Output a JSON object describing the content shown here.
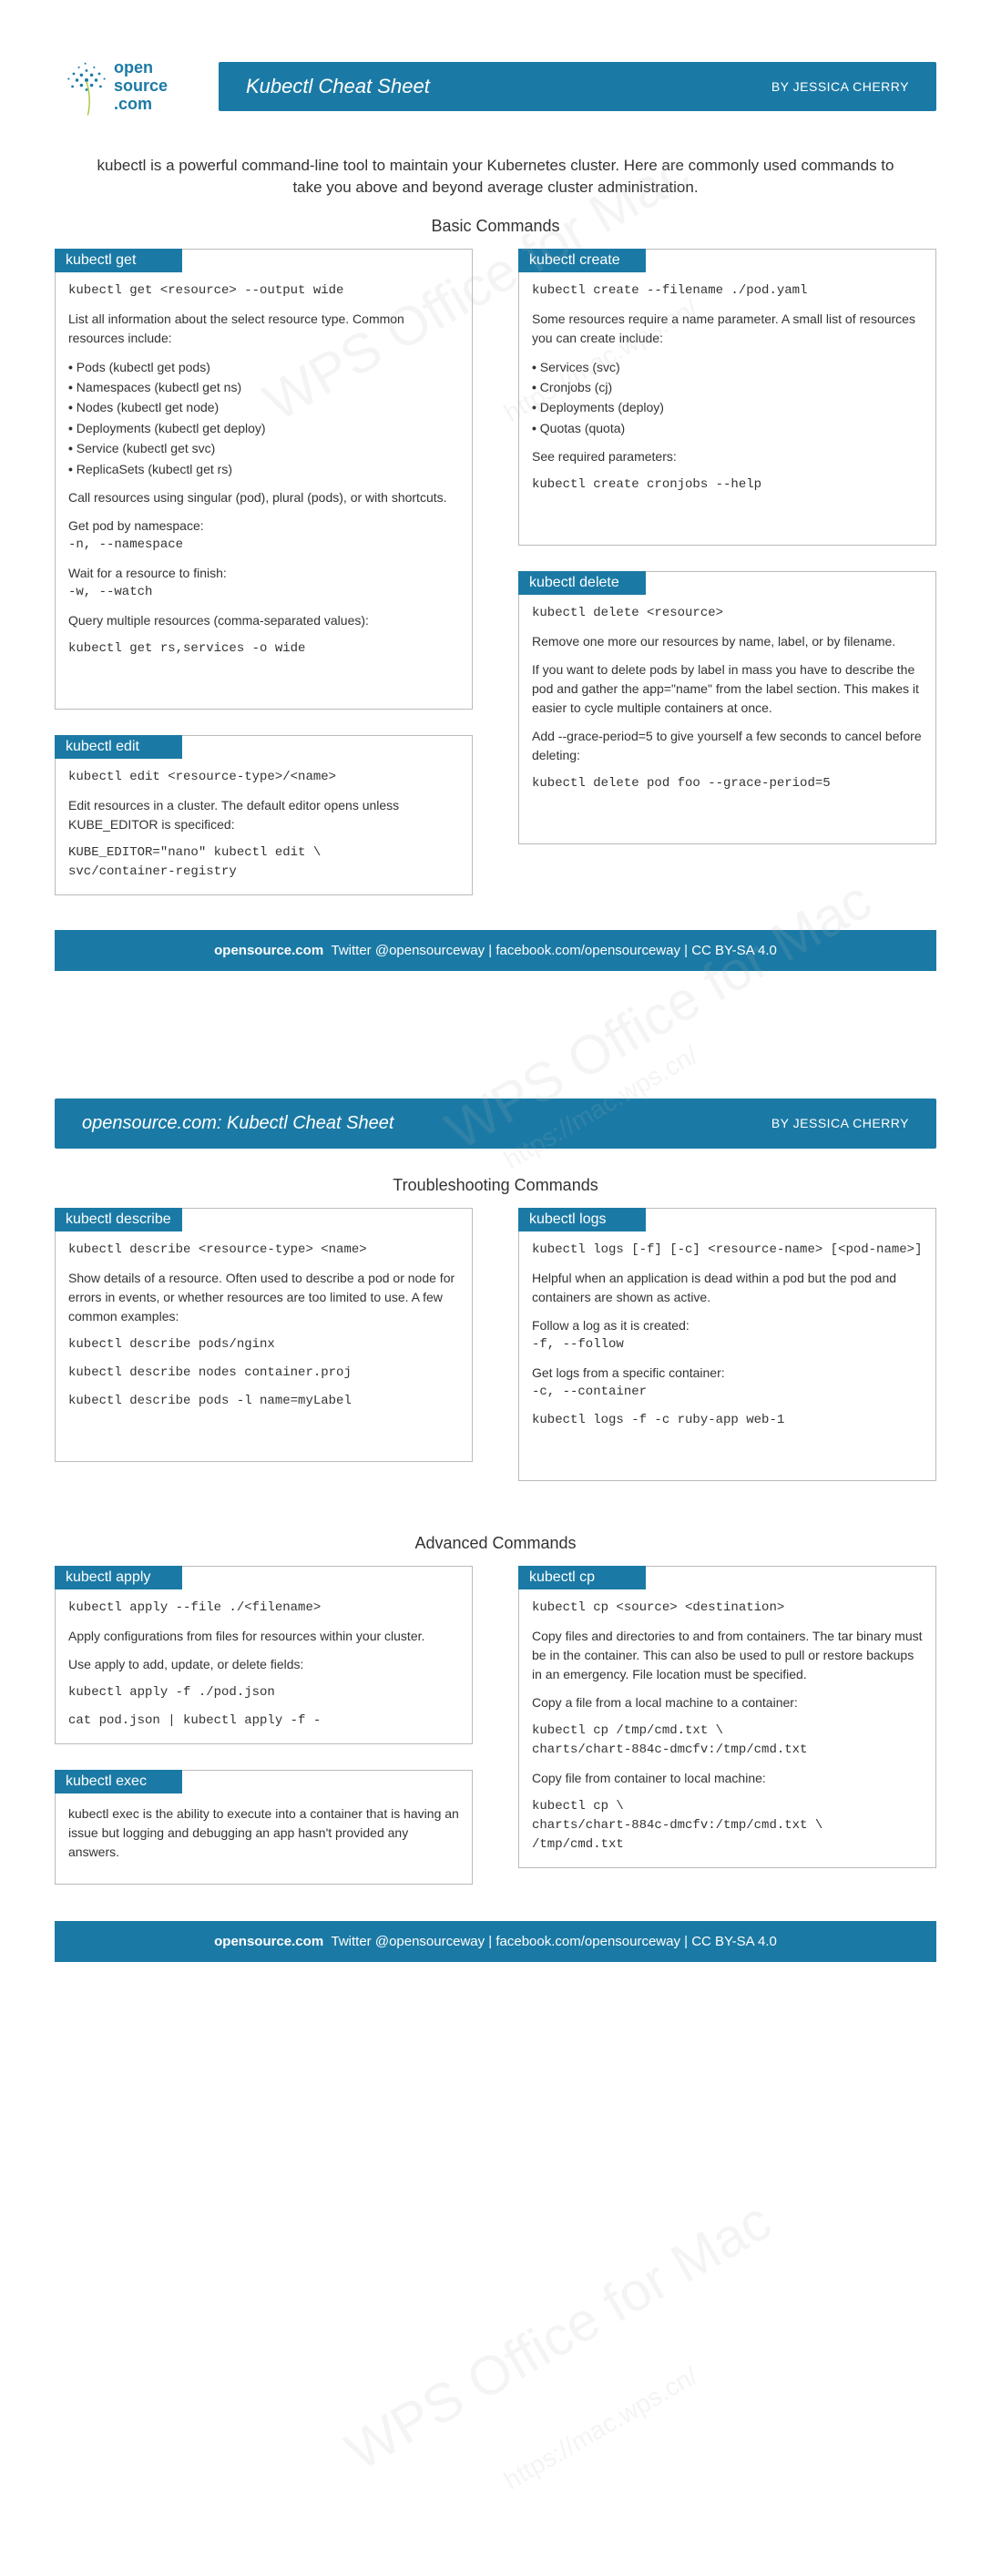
{
  "brand": {
    "name": "open\nsource\n.com"
  },
  "title": "Kubectl Cheat Sheet",
  "byline": "BY JESSICA CHERRY",
  "intro": "kubectl is a powerful command-line tool to maintain your Kubernetes cluster. Here are commonly used commands to take you above and beyond average cluster administration.",
  "section_basic": "Basic Commands",
  "section_trouble": "Troubleshooting Commands",
  "section_advanced": "Advanced Commands",
  "footer": "opensource.com  Twitter  @opensourceway  |  facebook.com/opensourceway  |  CC  BY-SA  4.0",
  "page2_title": "opensource.com:  Kubectl  Cheat  Sheet",
  "cards": {
    "get": {
      "h": "kubectl get",
      "cmd": "kubectl get <resource> --output wide",
      "line1": "List all information about the select resource type. Common resources include:",
      "li1": "Pods (kubectl get pods)",
      "li2": "Namespaces (kubectl get ns)",
      "li3": "Nodes (kubectl get node)",
      "li4": "Deployments (kubectl get deploy)",
      "li5": "Service (kubectl get svc)",
      "li6": "ReplicaSets (kubectl get rs)",
      "line2": "Call resources using singular (pod), plural (pods), or with shortcuts.",
      "line3": "Get pod by namespace:",
      "flag1": "-n, --namespace",
      "line4": "Wait for a resource to finish:",
      "flag2": "-w, --watch",
      "line5": "Query multiple resources (comma-separated values):",
      "cmd2": "kubectl get rs,services -o wide"
    },
    "edit": {
      "h": "kubectl edit",
      "cmd": "kubectl edit <resource-type>/<name>",
      "line1": "Edit resources in a cluster. The default editor opens unless KUBE_EDITOR is specificed:",
      "cmd2": "KUBE_EDITOR=\"nano\" kubectl edit \\\nsvc/container-registry"
    },
    "create": {
      "h": "kubectl create",
      "cmd": "kubectl create --filename ./pod.yaml",
      "line1": "Some resources require a name parameter. A small list of resources you can create include:",
      "li1": "Services (svc)",
      "li2": "Cronjobs (cj)",
      "li3": "Deployments (deploy)",
      "li4": "Quotas (quota)",
      "line2": "See required parameters:",
      "cmd2": "kubectl create cronjobs --help"
    },
    "delete": {
      "h": "kubectl delete",
      "cmd": "kubectl delete <resource>",
      "line1": "Remove one more our resources by name, label, or by filename.",
      "line2": "If you want to delete pods by label in mass you have to describe the pod and gather the app=\"name\" from the label section. This makes it easier to cycle multiple containers at once.",
      "line3": "Add --grace-period=5 to give yourself a few seconds to cancel before deleting:",
      "cmd2": "kubectl delete pod foo --grace-period=5"
    },
    "describe": {
      "h": "kubectl describe",
      "cmd": "kubectl describe <resource-type> <name>",
      "line1": "Show details of a resource. Often used to describe a pod or node for errors in events, or whether resources are too limited to use. A few common examples:",
      "cmd2": "kubectl describe pods/nginx",
      "cmd3": "kubectl describe nodes container.proj",
      "cmd4": "kubectl describe pods -l name=myLabel"
    },
    "logs": {
      "h": "kubectl logs",
      "cmd": "kubectl logs [-f] [-c] <resource-name> [<pod-name>]",
      "line1": "Helpful when an application is dead within a pod but the pod and containers are shown as active.",
      "line2": "Follow a log as it is created:",
      "flag1": "-f, --follow",
      "line3": "Get logs from a specific container:",
      "flag2": "-c, --container",
      "cmd2": "kubectl logs -f -c ruby-app web-1"
    },
    "apply": {
      "h": "kubectl apply",
      "cmd": "kubectl apply --file ./<filename>",
      "line1": "Apply configurations from files for resources within your cluster.",
      "line2": "Use apply to add, update, or delete fields:",
      "cmd2": "kubectl apply -f ./pod.json",
      "cmd3": "cat pod.json | kubectl apply -f -"
    },
    "exec": {
      "h": "kubectl exec",
      "line1": "kubectl exec is the ability to execute into a container that is having an issue but logging and debugging an app hasn't provided any answers."
    },
    "cp": {
      "h": "kubectl cp",
      "cmd": "kubectl cp <source> <destination>",
      "line1": "Copy files and directories to and from containers. The tar binary must be in the container. This can also be used to pull or restore backups in an emergency. File location must be specified.",
      "line2": "Copy a file from a local machine to a container:",
      "cmd2": "kubectl cp /tmp/cmd.txt \\\ncharts/chart-884c-dmcfv:/tmp/cmd.txt",
      "line3": "Copy file from container to local machine:",
      "cmd3": "kubectl cp \\\ncharts/chart-884c-dmcfv:/tmp/cmd.txt \\\n/tmp/cmd.txt"
    }
  }
}
